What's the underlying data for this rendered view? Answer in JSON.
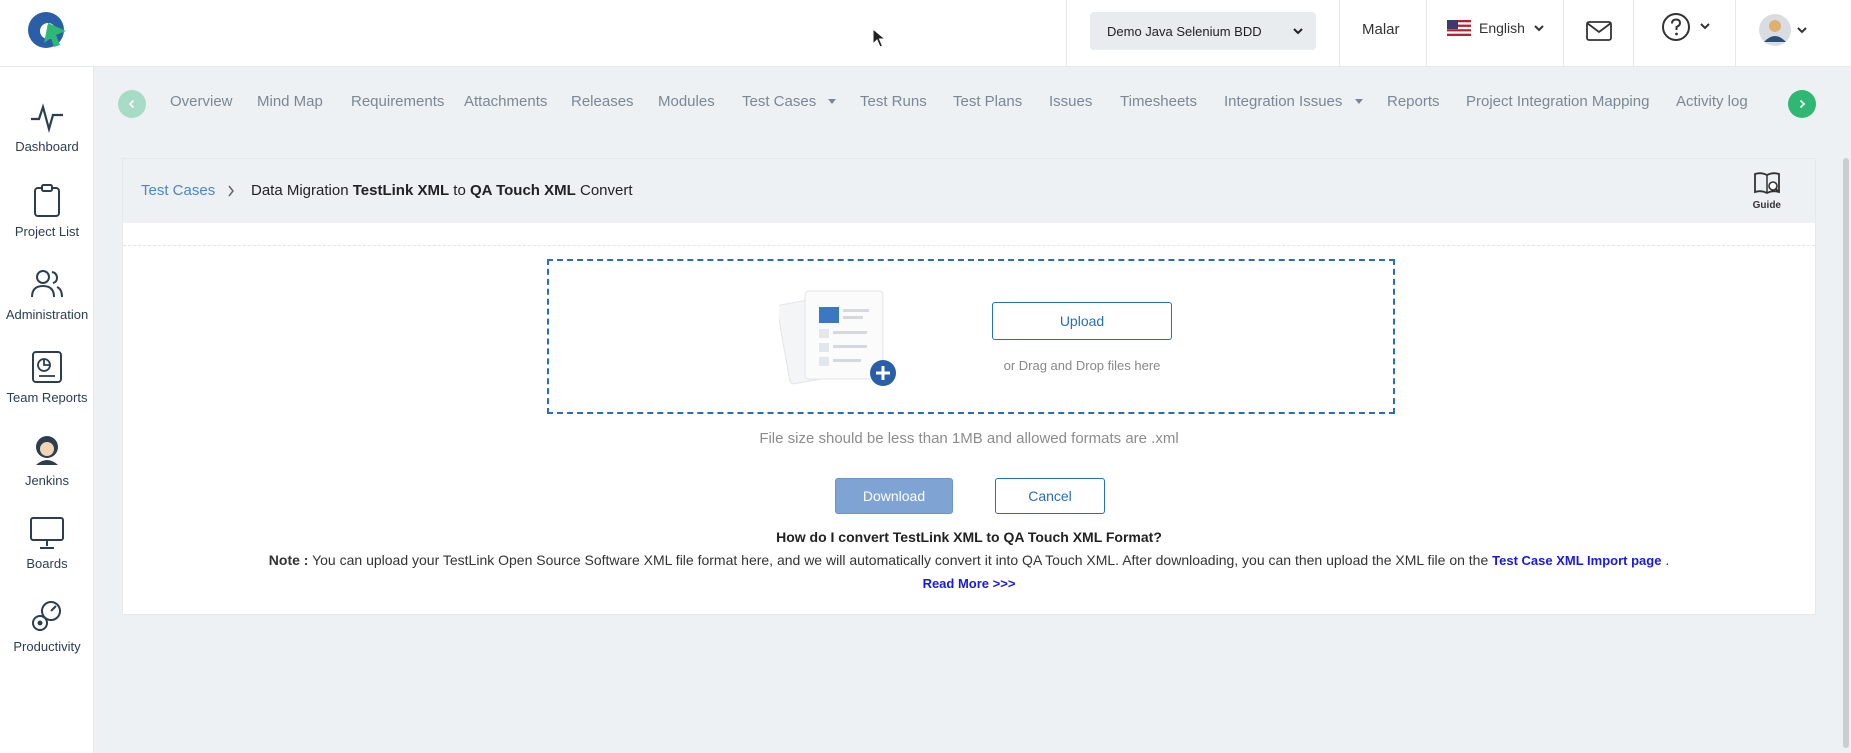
{
  "header": {
    "project_selected": "Demo Java Selenium BDD",
    "user_name": "Malar",
    "language": "English"
  },
  "sidebar": {
    "items": [
      {
        "label": "Dashboard"
      },
      {
        "label": "Project List"
      },
      {
        "label": "Administration"
      },
      {
        "label": "Team Reports"
      },
      {
        "label": "Jenkins"
      },
      {
        "label": "Boards"
      },
      {
        "label": "Productivity"
      }
    ]
  },
  "nav": {
    "tabs": [
      {
        "label": "Overview"
      },
      {
        "label": "Mind Map"
      },
      {
        "label": "Requirements"
      },
      {
        "label": "Attachments"
      },
      {
        "label": "Releases"
      },
      {
        "label": "Modules"
      },
      {
        "label": "Test Cases"
      },
      {
        "label": "Test Runs"
      },
      {
        "label": "Test Plans"
      },
      {
        "label": "Issues"
      },
      {
        "label": "Timesheets"
      },
      {
        "label": "Integration Issues"
      },
      {
        "label": "Reports"
      },
      {
        "label": "Project Integration Mapping"
      },
      {
        "label": "Activity log"
      }
    ]
  },
  "breadcrumb": {
    "link": "Test Cases",
    "title_prefix": "Data Migration",
    "title_source": "TestLink XML",
    "title_to": "to",
    "title_target": "QA Touch XML",
    "title_suffix": "Convert"
  },
  "guide_label": "Guide",
  "upload": {
    "button_label": "Upload",
    "drag_text": "or Drag and Drop files here",
    "size_hint": "File size should be less than 1MB and allowed formats are .xml"
  },
  "actions": {
    "download_label": "Download",
    "cancel_label": "Cancel"
  },
  "help_text": {
    "question": "How do I convert TestLink XML to QA Touch XML Format?",
    "note_label": "Note :",
    "note_body": "You can upload your TestLink Open Source Software XML file format here, and we will automatically convert it into QA Touch XML. After downloading, you can then upload the XML file on the",
    "note_link": "Test Case XML Import page",
    "note_end": ".",
    "read_more": "Read More >>>"
  },
  "colors": {
    "accent": "#2a6fb3",
    "nav_next": "#2eb873",
    "link": "#1a1adb"
  }
}
